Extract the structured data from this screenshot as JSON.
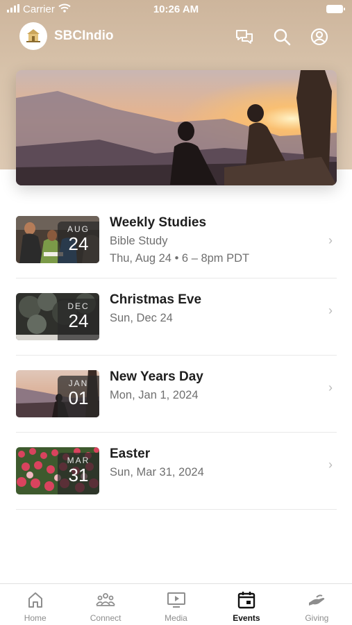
{
  "status_bar": {
    "carrier": "Carrier",
    "time": "10:26 AM"
  },
  "header": {
    "app_name": "SBCIndio"
  },
  "events": [
    {
      "month": "AUG",
      "day": "24",
      "title": "Weekly Studies",
      "subtitle": "Bible Study",
      "detail": "Thu, Aug 24 • 6 – 8pm PDT"
    },
    {
      "month": "DEC",
      "day": "24",
      "title": "Christmas Eve",
      "subtitle": "Sun, Dec 24"
    },
    {
      "month": "JAN",
      "day": "01",
      "title": "New Years Day",
      "subtitle": "Mon, Jan 1, 2024"
    },
    {
      "month": "MAR",
      "day": "31",
      "title": "Easter",
      "subtitle": "Sun, Mar 31, 2024"
    }
  ],
  "tabs": [
    {
      "label": "Home",
      "icon": "home-icon"
    },
    {
      "label": "Connect",
      "icon": "people-icon"
    },
    {
      "label": "Media",
      "icon": "play-screen-icon"
    },
    {
      "label": "Events",
      "icon": "calendar-icon",
      "active": true
    },
    {
      "label": "Giving",
      "icon": "giving-hand-icon"
    }
  ],
  "colors": {
    "header_bg": "#d8c3ab",
    "active_tab": "#111111",
    "inactive_tab": "#8d8d8d"
  }
}
